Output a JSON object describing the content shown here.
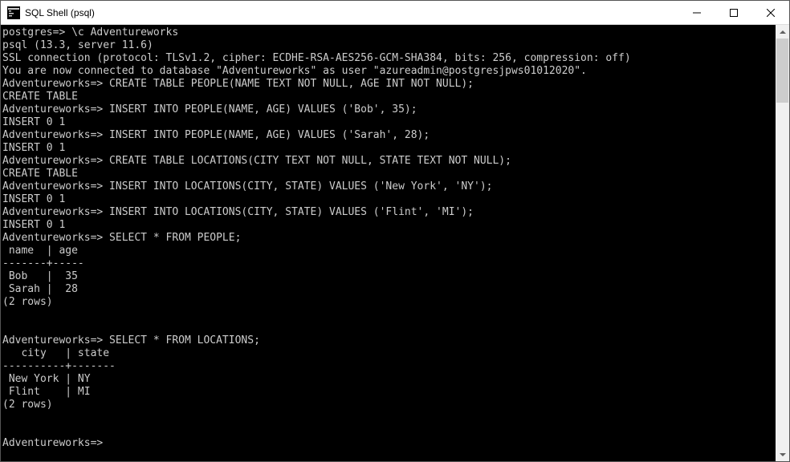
{
  "window": {
    "title": "SQL Shell (psql)"
  },
  "terminal": {
    "lines": [
      "postgres=> \\c Adventureworks",
      "psql (13.3, server 11.6)",
      "SSL connection (protocol: TLSv1.2, cipher: ECDHE-RSA-AES256-GCM-SHA384, bits: 256, compression: off)",
      "You are now connected to database \"Adventureworks\" as user \"azureadmin@postgresjpws01012020\".",
      "Adventureworks=> CREATE TABLE PEOPLE(NAME TEXT NOT NULL, AGE INT NOT NULL);",
      "CREATE TABLE",
      "Adventureworks=> INSERT INTO PEOPLE(NAME, AGE) VALUES ('Bob', 35);",
      "INSERT 0 1",
      "Adventureworks=> INSERT INTO PEOPLE(NAME, AGE) VALUES ('Sarah', 28);",
      "INSERT 0 1",
      "Adventureworks=> CREATE TABLE LOCATIONS(CITY TEXT NOT NULL, STATE TEXT NOT NULL);",
      "CREATE TABLE",
      "Adventureworks=> INSERT INTO LOCATIONS(CITY, STATE) VALUES ('New York', 'NY');",
      "INSERT 0 1",
      "Adventureworks=> INSERT INTO LOCATIONS(CITY, STATE) VALUES ('Flint', 'MI');",
      "INSERT 0 1",
      "Adventureworks=> SELECT * FROM PEOPLE;",
      " name  | age",
      "-------+-----",
      " Bob   |  35",
      " Sarah |  28",
      "(2 rows)",
      "",
      "",
      "Adventureworks=> SELECT * FROM LOCATIONS;",
      "   city   | state",
      "----------+-------",
      " New York | NY",
      " Flint    | MI",
      "(2 rows)",
      "",
      "",
      "Adventureworks=>"
    ]
  }
}
